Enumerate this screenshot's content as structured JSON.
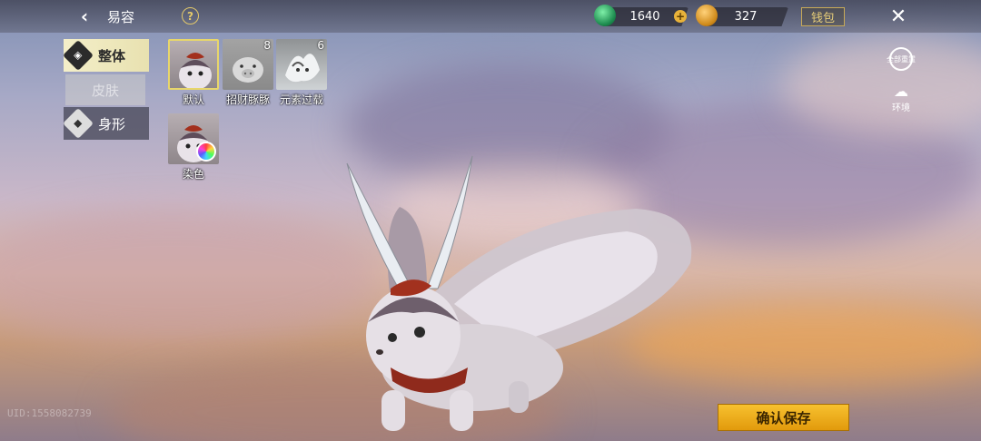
{
  "header": {
    "title": "易容",
    "help_label": "?",
    "jade_amount": "1640",
    "plus_label": "+",
    "gold_amount": "327",
    "wallet_label": "钱包",
    "close_glyph": "✕",
    "back_glyph": "‹"
  },
  "tabs": [
    {
      "label": "整体",
      "icon": "overall-icon",
      "state": "selected"
    },
    {
      "label": "皮肤",
      "icon": "none",
      "state": "disabled"
    },
    {
      "label": "身形",
      "icon": "shape-icon",
      "state": "normal"
    }
  ],
  "items": [
    {
      "label": "默认",
      "lock_count": "",
      "selected": true
    },
    {
      "label": "招财豚豚",
      "lock_count": "8",
      "selected": false
    },
    {
      "label": "元素过载",
      "lock_count": "6",
      "selected": false
    },
    {
      "label": "染色",
      "lock_count": "",
      "selected": false
    }
  ],
  "side_buttons": {
    "reset_label": "全部重置",
    "env_label": "环境"
  },
  "footer": {
    "uid_text": "UID:1558082739",
    "save_label": "确认保存"
  },
  "colors": {
    "accent_gold": "#e8b23a",
    "selected_border": "#e8d66a",
    "save_button": "#f7c12f",
    "tab_selected": "#f4efc9"
  }
}
